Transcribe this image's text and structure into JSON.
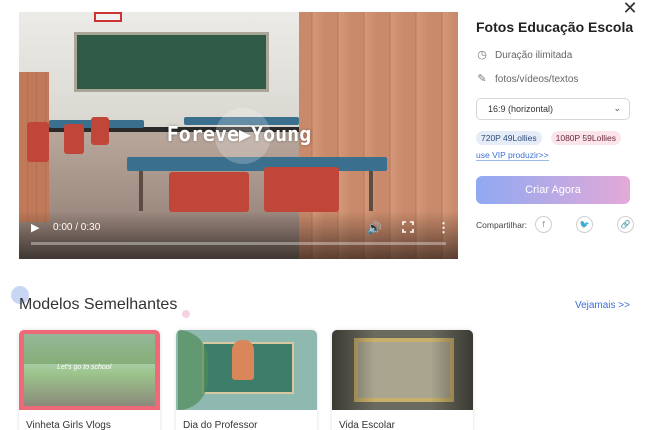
{
  "video": {
    "overlay_title": "Foreve▶Young",
    "time_display": "0:00 / 0:30",
    "progress": 0.0
  },
  "panel": {
    "title": "Fotos Educação Escola",
    "duration": "Duração ilimitada",
    "content_types": "fotos/vídeos/textos",
    "ratio_selected": "16:9 (horizontal)",
    "badges": [
      "720P 49Lollies",
      "1080P 59Lollies"
    ],
    "vip_link": "use VIP produzir>>",
    "cta_label": "Criar Agora",
    "share_label": "Compartilhar:",
    "share_icons": [
      "facebook-icon",
      "twitter-icon",
      "link-icon"
    ]
  },
  "similar": {
    "title": "Modelos Semelhantes",
    "see_more": "Vejamais >>",
    "cards": [
      {
        "label": "Vinheta Girls Vlogs",
        "caption": "Let's go to school"
      },
      {
        "label": "Dia do Professor"
      },
      {
        "label": "Vida Escolar"
      }
    ]
  },
  "colors": {
    "accent_link": "#3d6fd8",
    "cta_gradient_start": "#8fa9f2",
    "cta_gradient_end": "#e4a9d8"
  }
}
